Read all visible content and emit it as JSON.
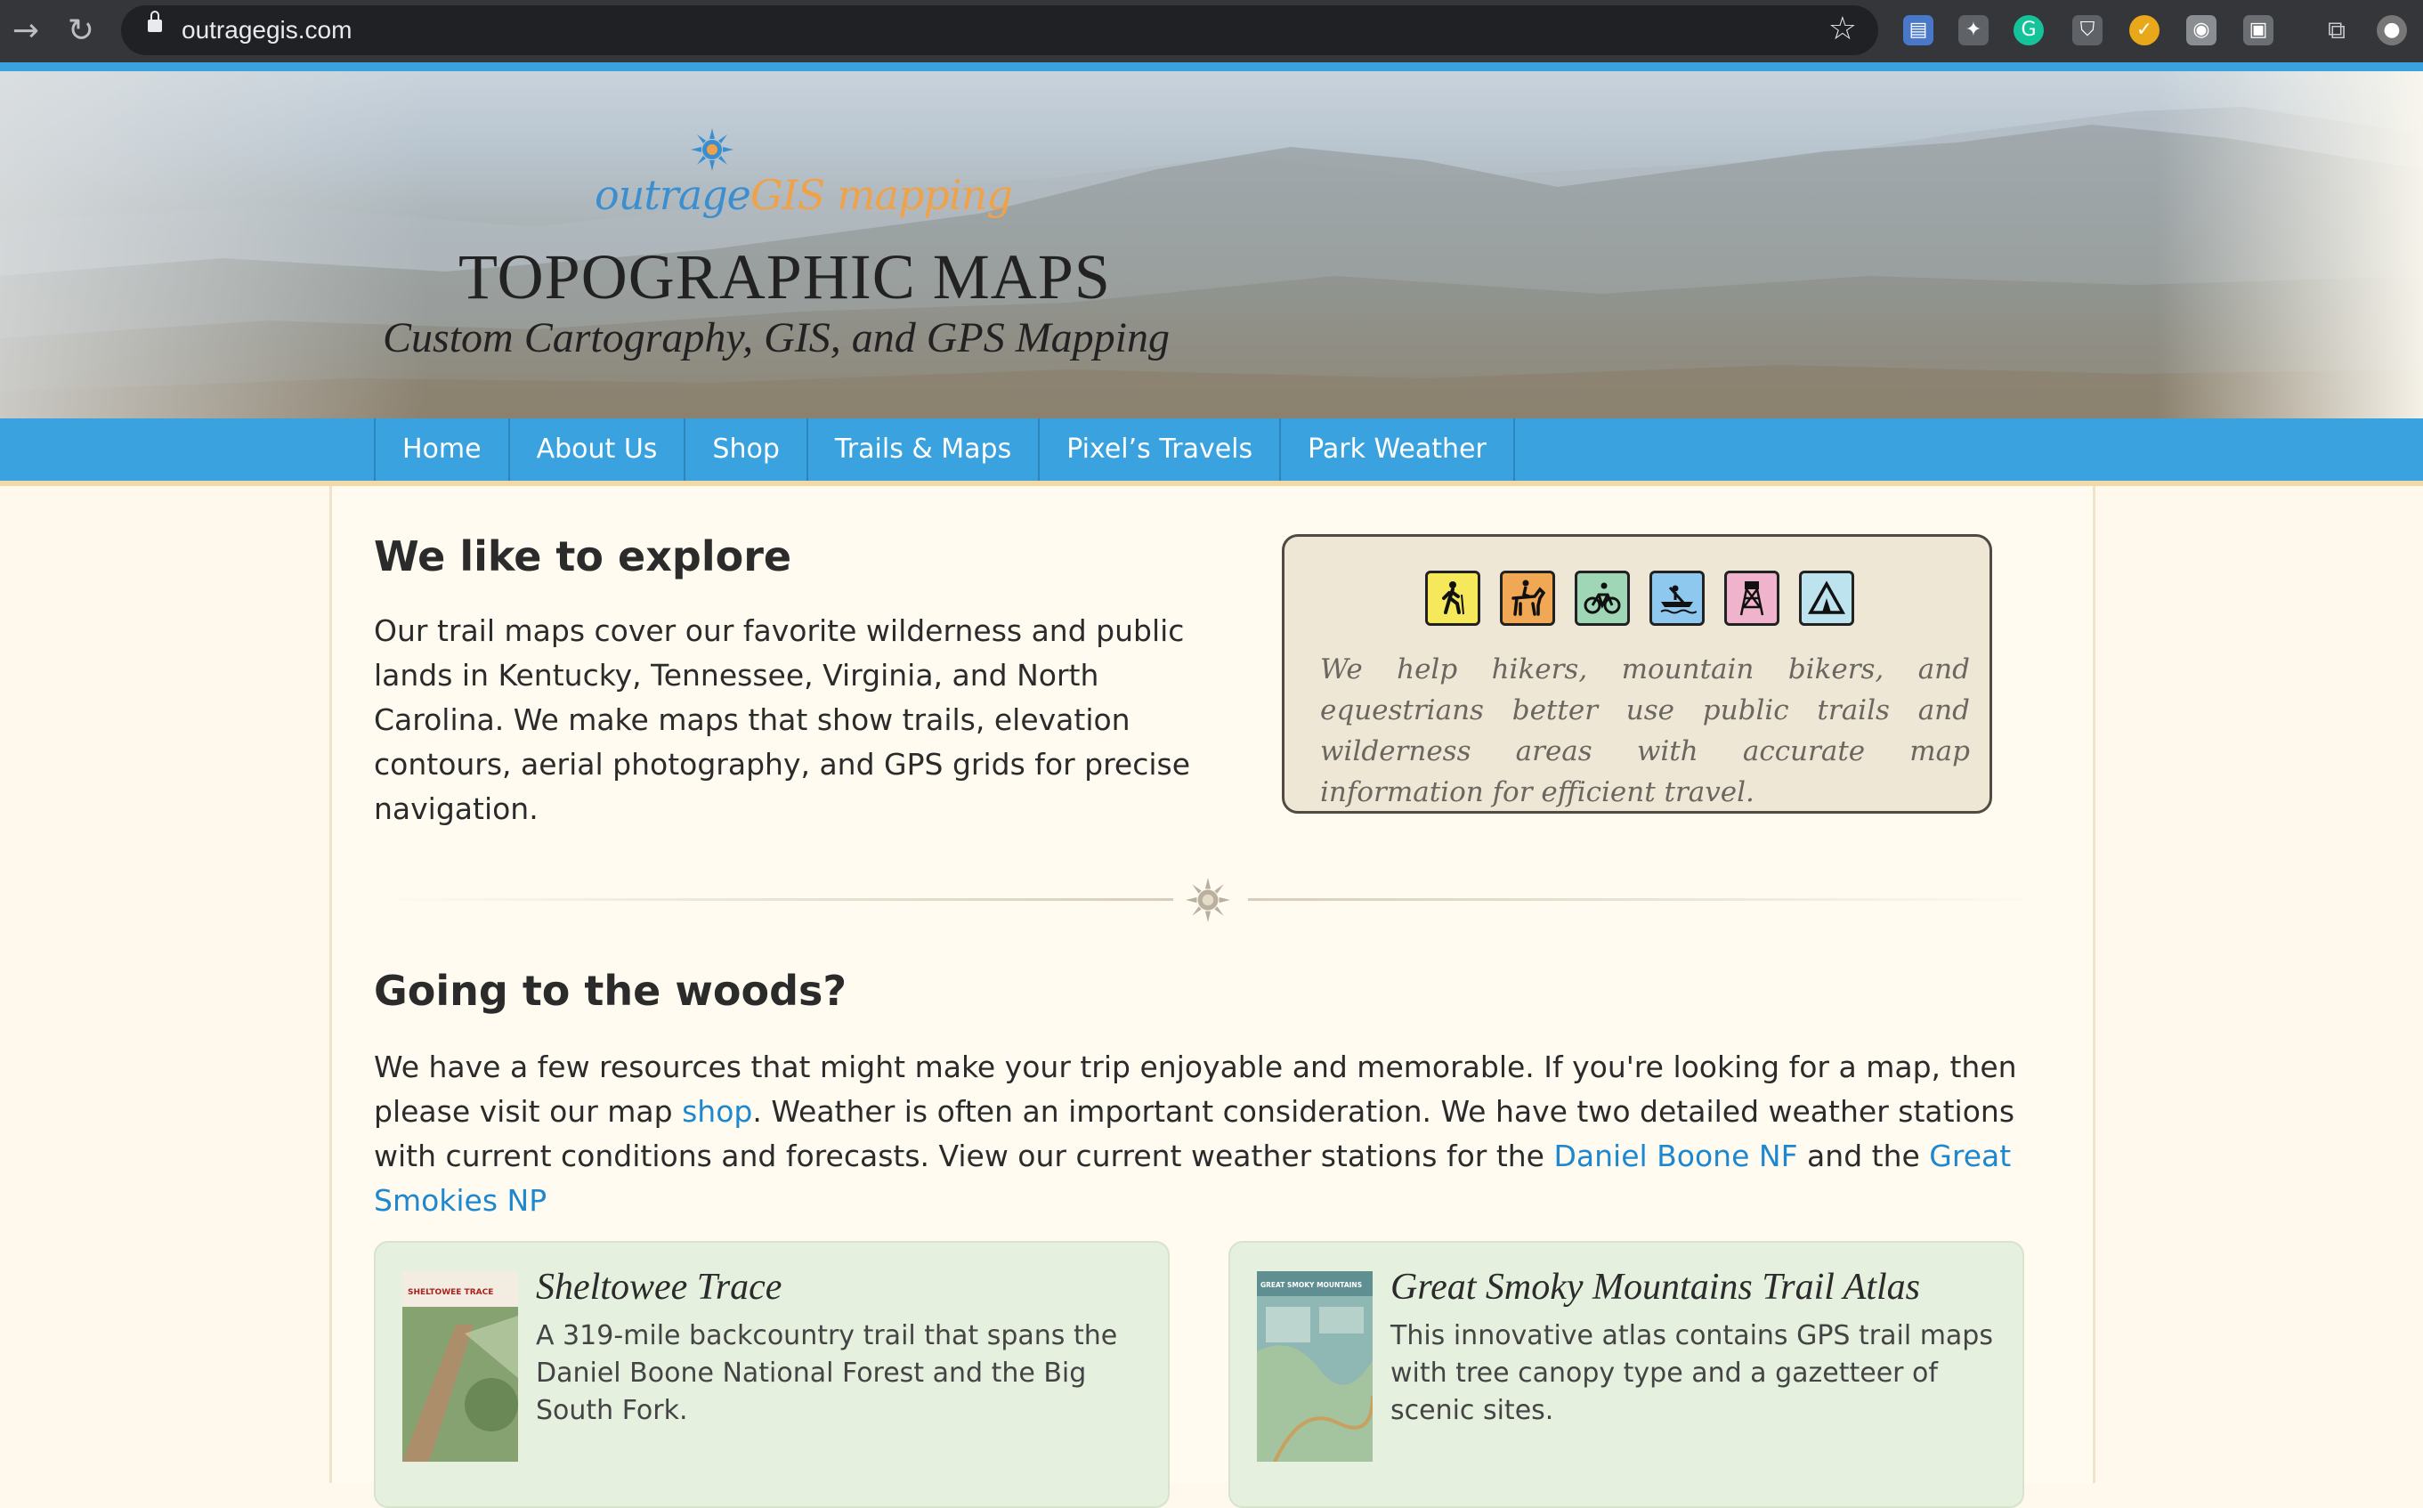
{
  "browser": {
    "url": "outragegis.com",
    "icons": [
      "back-arrow-icon",
      "reload-icon",
      "lock-icon",
      "bookmark-star-icon",
      "extension-icon",
      "grammarly-icon",
      "cast-icon",
      "profile-avatar-icon"
    ]
  },
  "header": {
    "logo_part1": "outrage",
    "logo_part2": "GIS mapping",
    "title": "TOPOGRAPHIC MAPS",
    "subtitle": "Custom Cartography, GIS, and GPS Mapping"
  },
  "nav": {
    "items": [
      {
        "label": "Home"
      },
      {
        "label": "About Us"
      },
      {
        "label": "Shop"
      },
      {
        "label": "Trails & Maps"
      },
      {
        "label": "Pixel’s Travels"
      },
      {
        "label": "Park Weather"
      }
    ]
  },
  "explore": {
    "heading": "We like to explore",
    "body": "Our trail maps cover our favorite wilderness and public lands in Kentucky, Tennessee, Virginia, and North Carolina. We make maps that show trails, elevation contours, aerial photography, and GPS grids for precise navigation.",
    "callout": "We help hikers, mountain bikers, and equestrians better use public trails and wilderness areas with accurate map information for efficient travel.",
    "activity_icons": [
      {
        "name": "hiker-icon",
        "color": "#f5e85a"
      },
      {
        "name": "horse-rider-icon",
        "color": "#f0a855"
      },
      {
        "name": "bicycle-icon",
        "color": "#9fd6b6"
      },
      {
        "name": "canoe-icon",
        "color": "#8fc8ee"
      },
      {
        "name": "fire-tower-icon",
        "color": "#efb4cc"
      },
      {
        "name": "campsite-tent-icon",
        "color": "#bde3ef"
      }
    ]
  },
  "woods": {
    "heading": "Going to the woods?",
    "text1": "We have a few resources that might make your trip enjoyable and memorable. If you're looking for a map, then please visit our map ",
    "link_shop": "shop",
    "text2": ". Weather is often an important consideration. We have two detailed weather stations with current conditions and forecasts. View our current weather stations for the ",
    "link_boone": "Daniel Boone NF",
    "text3": " and the ",
    "link_smokies": "Great Smokies NP"
  },
  "cards": [
    {
      "title": "Sheltowee Trace",
      "desc": "A 319-mile backcountry trail that spans the Daniel Boone National Forest and the Big South Fork.",
      "thumb_label": "SHELTOWEE TRACE"
    },
    {
      "title": "Great Smoky Mountains Trail Atlas",
      "desc": "This innovative atlas contains GPS trail maps with tree canopy type and a gazetteer of scenic sites.",
      "thumb_label": "GREAT SMOKY MOUNTAINS"
    }
  ]
}
